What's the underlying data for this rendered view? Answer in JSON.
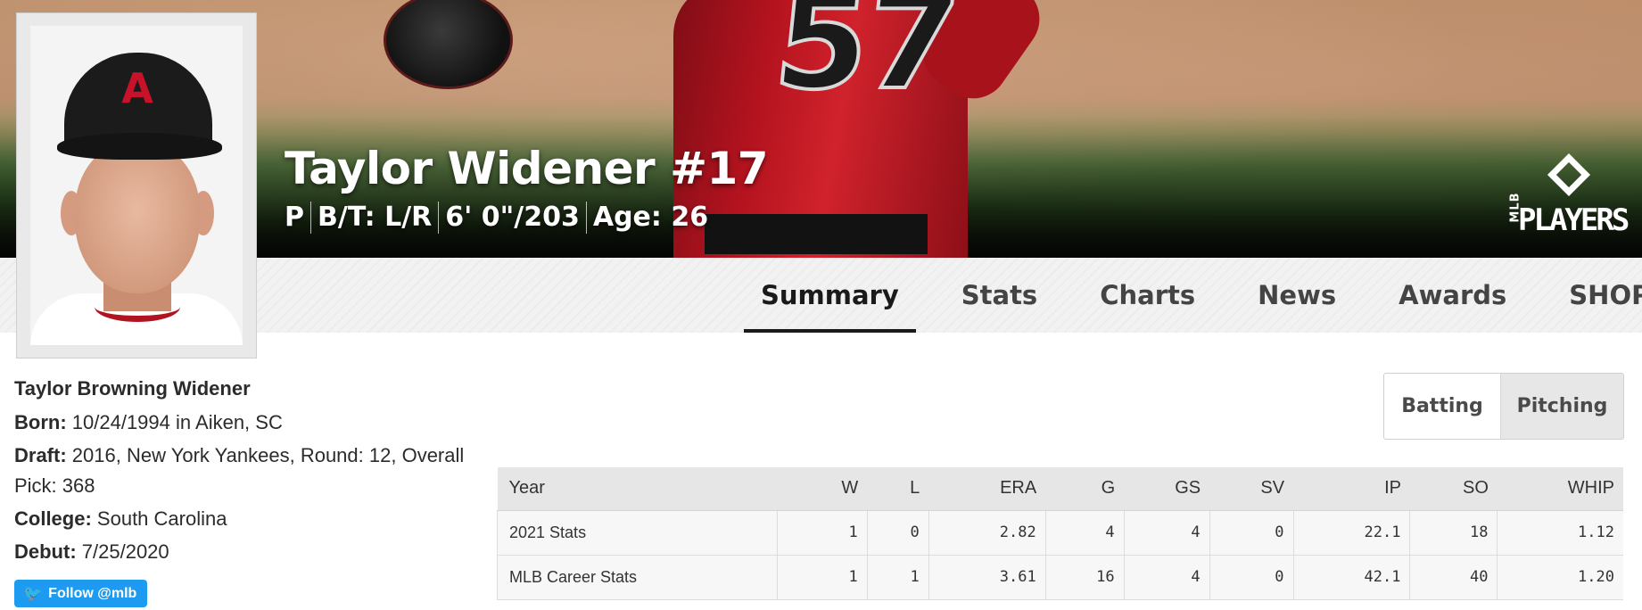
{
  "hero": {
    "name": "Taylor Widener #17",
    "meta": [
      "P",
      "B/T: L/R",
      "6' 0\"/203",
      "Age: 26"
    ],
    "jersey_number": "57",
    "logo": {
      "mlb": "MLB",
      "players": "PLAYERS"
    }
  },
  "nav": {
    "tabs": [
      "Summary",
      "Stats",
      "Charts",
      "News",
      "Awards",
      "SHOP"
    ],
    "active_tab": "Summary"
  },
  "headshot": {
    "cap_logo": "A"
  },
  "bio": {
    "full_name": "Taylor Browning Widener",
    "born_label": "Born:",
    "born_value": "10/24/1994 in Aiken, SC",
    "draft_label": "Draft:",
    "draft_value": "2016, New York Yankees, Round: 12, Overall Pick: 368",
    "college_label": "College:",
    "college_value": "South Carolina",
    "debut_label": "Debut:",
    "debut_value": "7/25/2020",
    "follow_label": "Follow @mlb"
  },
  "stat_toggle": {
    "batting": "Batting",
    "pitching": "Pitching",
    "selected": "Pitching"
  },
  "stats": {
    "columns": [
      "Year",
      "W",
      "L",
      "ERA",
      "G",
      "GS",
      "SV",
      "IP",
      "SO",
      "WHIP"
    ],
    "rows": [
      [
        "2021 Stats",
        "1",
        "0",
        "2.82",
        "4",
        "4",
        "0",
        "22.1",
        "18",
        "1.12"
      ],
      [
        "MLB Career Stats",
        "1",
        "1",
        "3.61",
        "16",
        "4",
        "0",
        "42.1",
        "40",
        "1.20"
      ]
    ]
  },
  "colors": {
    "jersey_red": "#c41a24",
    "twitter_blue": "#1d9bf0",
    "tab_underline": "#1a1a1a"
  }
}
